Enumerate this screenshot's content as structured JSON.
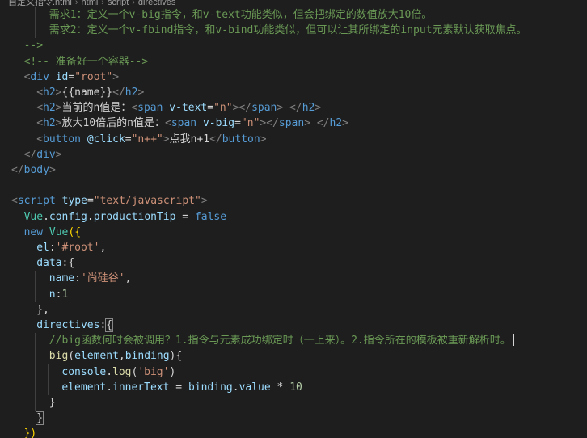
{
  "breadcrumb": {
    "items": [
      "自定义指令.html",
      "html",
      "script",
      "directives"
    ]
  },
  "editor": {
    "lines": [
      {
        "indent": 3,
        "tokens": [
          [
            "t-comment",
            "需求1：定义一个v-big指令，和v-text功能类似，但会把绑定的数值放大10倍。"
          ]
        ]
      },
      {
        "indent": 3,
        "tokens": [
          [
            "t-comment",
            "需求2：定义一个v-fbind指令，和v-bind功能类似，但可以让其所绑定的input元素默认获取焦点。"
          ]
        ]
      },
      {
        "indent": 1,
        "tokens": [
          [
            "t-comment",
            "-->"
          ]
        ]
      },
      {
        "indent": 1,
        "tokens": [
          [
            "t-comment",
            "<!-- 准备好一个容器-->"
          ]
        ]
      },
      {
        "indent": 1,
        "tokens": [
          [
            "t-punct",
            "<"
          ],
          [
            "t-tag",
            "div"
          ],
          [
            "t-plain",
            " "
          ],
          [
            "t-attr",
            "id"
          ],
          [
            "t-plain",
            "="
          ],
          [
            "t-str",
            "\"root\""
          ],
          [
            "t-punct",
            ">"
          ]
        ]
      },
      {
        "indent": 2,
        "tokens": [
          [
            "t-punct",
            "<"
          ],
          [
            "t-tag",
            "h2"
          ],
          [
            "t-punct",
            ">"
          ],
          [
            "t-text",
            "{{name}}"
          ],
          [
            "t-punct",
            "</"
          ],
          [
            "t-tag",
            "h2"
          ],
          [
            "t-punct",
            ">"
          ]
        ]
      },
      {
        "indent": 2,
        "tokens": [
          [
            "t-punct",
            "<"
          ],
          [
            "t-tag",
            "h2"
          ],
          [
            "t-punct",
            ">"
          ],
          [
            "t-text",
            "当前的n值是："
          ],
          [
            "t-punct",
            "<"
          ],
          [
            "t-tag",
            "span"
          ],
          [
            "t-plain",
            " "
          ],
          [
            "t-attr",
            "v-text"
          ],
          [
            "t-plain",
            "="
          ],
          [
            "t-str",
            "\"n\""
          ],
          [
            "t-punct",
            "></"
          ],
          [
            "t-tag",
            "span"
          ],
          [
            "t-punct",
            ">"
          ],
          [
            "t-plain",
            " "
          ],
          [
            "t-punct",
            "</"
          ],
          [
            "t-tag",
            "h2"
          ],
          [
            "t-punct",
            ">"
          ]
        ]
      },
      {
        "indent": 2,
        "tokens": [
          [
            "t-punct",
            "<"
          ],
          [
            "t-tag",
            "h2"
          ],
          [
            "t-punct",
            ">"
          ],
          [
            "t-text",
            "放大10倍后的n值是："
          ],
          [
            "t-punct",
            "<"
          ],
          [
            "t-tag",
            "span"
          ],
          [
            "t-plain",
            " "
          ],
          [
            "t-attr",
            "v-big"
          ],
          [
            "t-plain",
            "="
          ],
          [
            "t-str",
            "\"n\""
          ],
          [
            "t-punct",
            "></"
          ],
          [
            "t-tag",
            "span"
          ],
          [
            "t-punct",
            ">"
          ],
          [
            "t-plain",
            " "
          ],
          [
            "t-punct",
            "</"
          ],
          [
            "t-tag",
            "h2"
          ],
          [
            "t-punct",
            ">"
          ]
        ]
      },
      {
        "indent": 2,
        "tokens": [
          [
            "t-punct",
            "<"
          ],
          [
            "t-tag",
            "button"
          ],
          [
            "t-plain",
            " "
          ],
          [
            "t-attr",
            "@click"
          ],
          [
            "t-plain",
            "="
          ],
          [
            "t-str",
            "\"n++\""
          ],
          [
            "t-punct",
            ">"
          ],
          [
            "t-text",
            "点我n+1"
          ],
          [
            "t-punct",
            "</"
          ],
          [
            "t-tag",
            "button"
          ],
          [
            "t-punct",
            ">"
          ]
        ]
      },
      {
        "indent": 1,
        "tokens": [
          [
            "t-punct",
            "</"
          ],
          [
            "t-tag",
            "div"
          ],
          [
            "t-punct",
            ">"
          ]
        ]
      },
      {
        "indent": 0,
        "tokens": [
          [
            "t-punct",
            "</"
          ],
          [
            "t-tag",
            "body"
          ],
          [
            "t-punct",
            ">"
          ]
        ]
      },
      {
        "indent": 0,
        "tokens": []
      },
      {
        "indent": 0,
        "tokens": [
          [
            "t-punct",
            "<"
          ],
          [
            "t-tag",
            "script"
          ],
          [
            "t-plain",
            " "
          ],
          [
            "t-attr",
            "type"
          ],
          [
            "t-plain",
            "="
          ],
          [
            "t-str",
            "\"text/javascript\""
          ],
          [
            "t-punct",
            ">"
          ]
        ]
      },
      {
        "indent": 1,
        "tokens": [
          [
            "t-cls",
            "Vue"
          ],
          [
            "t-plain",
            "."
          ],
          [
            "t-prop",
            "config"
          ],
          [
            "t-plain",
            "."
          ],
          [
            "t-prop",
            "productionTip"
          ],
          [
            "t-plain",
            " = "
          ],
          [
            "t-kw",
            "false"
          ]
        ]
      },
      {
        "indent": 1,
        "tokens": [
          [
            "t-kw",
            "new"
          ],
          [
            "t-plain",
            " "
          ],
          [
            "t-cls",
            "Vue"
          ],
          [
            "t-yellow",
            "({"
          ]
        ]
      },
      {
        "indent": 2,
        "tokens": [
          [
            "t-prop",
            "el"
          ],
          [
            "t-plain",
            ":"
          ],
          [
            "t-str",
            "'#root'"
          ],
          [
            "t-plain",
            ","
          ]
        ]
      },
      {
        "indent": 2,
        "tokens": [
          [
            "t-prop",
            "data"
          ],
          [
            "t-plain",
            ":{"
          ]
        ]
      },
      {
        "indent": 3,
        "tokens": [
          [
            "t-prop",
            "name"
          ],
          [
            "t-plain",
            ":"
          ],
          [
            "t-str",
            "'尚硅谷'"
          ],
          [
            "t-plain",
            ","
          ]
        ]
      },
      {
        "indent": 3,
        "tokens": [
          [
            "t-prop",
            "n"
          ],
          [
            "t-plain",
            ":"
          ],
          [
            "t-num",
            "1"
          ]
        ]
      },
      {
        "indent": 2,
        "tokens": [
          [
            "t-plain",
            "},"
          ]
        ]
      },
      {
        "indent": 2,
        "tokens": [
          [
            "t-prop",
            "directives"
          ],
          [
            "t-plain",
            ":"
          ],
          [
            "t-plain bracket-box",
            "{"
          ]
        ],
        "highlight": true
      },
      {
        "indent": 3,
        "tokens": [
          [
            "t-comment",
            "//big函数何时会被调用？1.指令与元素成功绑定时（一上来）。2.指令所在的模板被重新解析时。"
          ]
        ],
        "cursor": true
      },
      {
        "indent": 3,
        "tokens": [
          [
            "t-fn",
            "big"
          ],
          [
            "t-plain",
            "("
          ],
          [
            "t-prop",
            "element"
          ],
          [
            "t-plain",
            ","
          ],
          [
            "t-prop",
            "binding"
          ],
          [
            "t-plain",
            "){"
          ]
        ]
      },
      {
        "indent": 4,
        "tokens": [
          [
            "t-prop",
            "console"
          ],
          [
            "t-plain",
            "."
          ],
          [
            "t-fn",
            "log"
          ],
          [
            "t-plain",
            "("
          ],
          [
            "t-str",
            "'big'"
          ],
          [
            "t-plain",
            ")"
          ]
        ]
      },
      {
        "indent": 4,
        "tokens": [
          [
            "t-prop",
            "element"
          ],
          [
            "t-plain",
            "."
          ],
          [
            "t-prop",
            "innerText"
          ],
          [
            "t-plain",
            " = "
          ],
          [
            "t-prop",
            "binding"
          ],
          [
            "t-plain",
            "."
          ],
          [
            "t-prop",
            "value"
          ],
          [
            "t-plain",
            " * "
          ],
          [
            "t-num",
            "10"
          ]
        ]
      },
      {
        "indent": 3,
        "tokens": [
          [
            "t-plain",
            "}"
          ]
        ]
      },
      {
        "indent": 2,
        "tokens": [
          [
            "t-plain bracket-box",
            "}"
          ]
        ]
      },
      {
        "indent": 1,
        "tokens": [
          [
            "t-yellow",
            "})"
          ]
        ]
      }
    ]
  }
}
